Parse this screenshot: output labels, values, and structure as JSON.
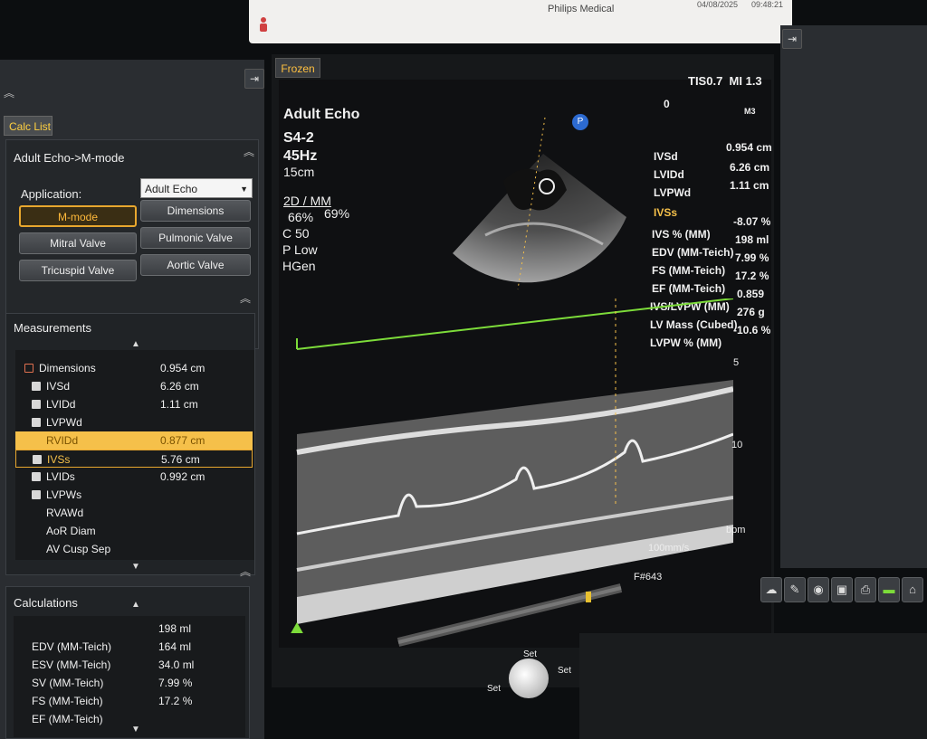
{
  "header": {
    "vendor": "Philips Medical",
    "date": "04/08/2025",
    "time": "09:48:21"
  },
  "left": {
    "calc_list_tab": "Calc List",
    "app_title": "Adult Echo->M-mode",
    "application_label": "Application:",
    "application_value": "Adult Echo",
    "buttons": {
      "mmode": "M-mode",
      "dimensions": "Dimensions",
      "mitral": "Mitral Valve",
      "pulmonic": "Pulmonic Valve",
      "tricuspid": "Tricuspid Valve",
      "aortic": "Aortic Valve"
    },
    "measurements_title": "Measurements",
    "measurements": [
      {
        "name": "Dimensions",
        "value": "0.954 cm"
      },
      {
        "name": "IVSd",
        "value": "6.26 cm"
      },
      {
        "name": "LVIDd",
        "value": "1.11 cm"
      },
      {
        "name": "LVPWd",
        "value": ""
      },
      {
        "name": "RVIDd",
        "value": "0.877 cm"
      },
      {
        "name": "IVSs",
        "value": "5.76 cm"
      },
      {
        "name": "LVIDs",
        "value": "0.992 cm"
      },
      {
        "name": "LVPWs",
        "value": ""
      },
      {
        "name": "RVAWd",
        "value": ""
      },
      {
        "name": "AoR Diam",
        "value": ""
      },
      {
        "name": "AV Cusp Sep",
        "value": ""
      }
    ],
    "calculations_title": "Calculations",
    "calculations": [
      {
        "name": "",
        "value": "198 ml"
      },
      {
        "name": "EDV (MM-Teich)",
        "value": "164 ml"
      },
      {
        "name": "ESV (MM-Teich)",
        "value": "34.0 ml"
      },
      {
        "name": "SV (MM-Teich)",
        "value": "7.99 %"
      },
      {
        "name": "FS (MM-Teich)",
        "value": "17.2 %"
      },
      {
        "name": "EF (MM-Teich)",
        "value": ""
      }
    ]
  },
  "center": {
    "frozen_tab": "Frozen",
    "exam": "Adult Echo",
    "probe": "S4-2",
    "rate": "45Hz",
    "depth": "15cm",
    "mode": "2D / MM",
    "gain1": "66%",
    "gain2": "69%",
    "compression": "C 50",
    "power": "P Low",
    "freq": "HGen",
    "tis": "TIS0.7",
    "mi": "MI 1.3",
    "m3": "M3",
    "scale_0": "0",
    "scale_5": "5",
    "scale_10": "10",
    "speed": "100mm/s",
    "bpm": "bpm",
    "frame": "F#643",
    "p_badge": "P",
    "measurements": [
      {
        "name": "IVSd",
        "value": "0.954 cm"
      },
      {
        "name": "LVIDd",
        "value": "6.26 cm"
      },
      {
        "name": "LVPWd",
        "value": "1.11 cm"
      },
      {
        "name": "IVSs",
        "value": ""
      },
      {
        "name": "IVS % (MM)",
        "value": "-8.07 %"
      },
      {
        "name": "EDV (MM-Teich)",
        "value": "198 ml"
      },
      {
        "name": "FS (MM-Teich)",
        "value": "7.99 %"
      },
      {
        "name": "EF (MM-Teich)",
        "value": "17.2 %"
      },
      {
        "name": "IVS/LVPW (MM)",
        "value": "0.859"
      },
      {
        "name": "LV Mass (Cubed)",
        "value": "276 g"
      },
      {
        "name": "LVPW % (MM)",
        "value": "-10.6 %"
      }
    ]
  },
  "set_control": {
    "top": "Set",
    "left": "Set",
    "right": "Set"
  },
  "icons": [
    "probe-icon",
    "wrench-icon",
    "globe-icon",
    "patient-icon",
    "print-icon",
    "battery-icon",
    "network-icon"
  ],
  "colors": {
    "accent": "#f5c04a",
    "active_orange": "#e8a72e",
    "trace_green": "#7ddc3a"
  }
}
